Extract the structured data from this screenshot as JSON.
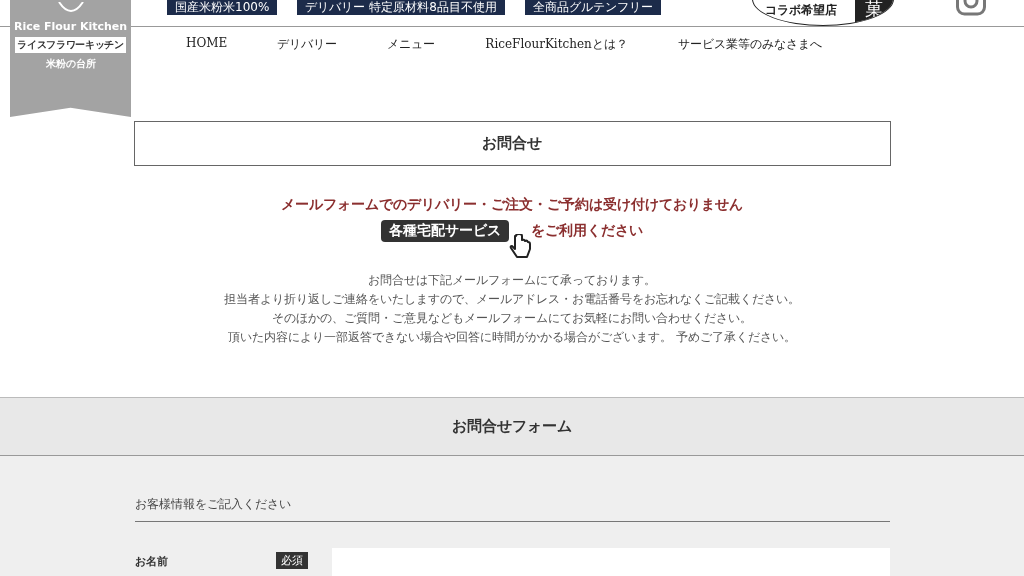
{
  "logo": {
    "name": "Rice Flour Kitchen",
    "kana": "ライスフラワーキッチン",
    "tagline": "米粉の台所"
  },
  "badges": [
    "国産米粉米100%",
    "デリバリー 特定原材料8品目不使用",
    "全商品グルテンフリー"
  ],
  "bubble": {
    "text": "コラボ希望店",
    "mark": "菓"
  },
  "nav": [
    "HOME",
    "デリバリー",
    "メニュー",
    "RiceFlourKitchenとは？",
    "サービス業等のみなさまへ"
  ],
  "page_title": "お問合せ",
  "notice": {
    "line1": "メールフォームでのデリバリー・ご注文・ご予約は受け付けておりません",
    "button": "各種宅配サービス",
    "line2": "をご利用ください"
  },
  "intro": [
    "お問合せは下記メールフォームにて承っております。",
    "担当者より折り返しご連絡をいたしますので、メールアドレス・お電話番号をお忘れなくご記載ください。",
    "そのほかの、ご質問・ご意見などもメールフォームにてお気軽にお問い合わせください。",
    "頂いた内容により一部返答できない場合や回答に時間がかかる場合がございます。 予めご了承ください。"
  ],
  "form": {
    "title": "お問合せフォーム",
    "section": "お客様情報をご記入ください",
    "fields": [
      {
        "label": "お名前",
        "required": true,
        "required_label": "必須"
      }
    ]
  }
}
